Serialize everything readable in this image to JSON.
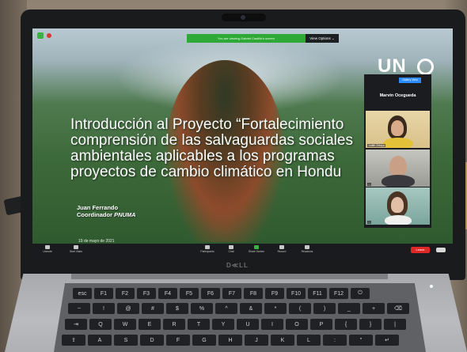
{
  "zoom": {
    "share_notice": "You are viewing Gabriel Castillo's screen",
    "view_options": "View Options ⌄",
    "panel_button": "Gallery View",
    "active_speaker": "Marvin Ocegueda",
    "participants": [
      "Judith Zelaya",
      "...",
      "..."
    ],
    "toolbar": {
      "unmute": "Unmute",
      "start_video": "Start Video",
      "participants": "Participants",
      "chat": "Chat",
      "share_screen": "Share Screen",
      "record": "Record",
      "reactions": "Reactions",
      "end": "Leave"
    }
  },
  "slide": {
    "logo": "UN",
    "title_lines": [
      "Introducción al Proyecto “Fortalecimiento",
      "comprensión de las salvaguardas sociales",
      "ambientales aplicables a los programas",
      "proyectos de cambio climático en Hondu"
    ],
    "presenter": "Juan Ferrando",
    "role_prefix": "Coordinador",
    "role_org": "PNUMA",
    "date": "19 de mayo de 2021"
  },
  "device": {
    "brand": "D≪LL"
  },
  "keyboard": {
    "row1": [
      "esc",
      "F1",
      "F2",
      "F3",
      "F4",
      "F5",
      "F6",
      "F7",
      "F8",
      "F9",
      "F10",
      "F11",
      "F12",
      "⏻"
    ],
    "row2": [
      "~",
      "!",
      "@",
      "#",
      "$",
      "%",
      "^",
      "&",
      "*",
      "(",
      ")",
      "_",
      "+",
      "⌫"
    ],
    "row3": [
      "⇥",
      "Q",
      "W",
      "E",
      "R",
      "T",
      "Y",
      "U",
      "I",
      "O",
      "P",
      "{",
      "}",
      "|"
    ],
    "row4": [
      "⇪",
      "A",
      "S",
      "D",
      "F",
      "G",
      "H",
      "J",
      "K",
      "L",
      ":",
      "\"",
      "↵"
    ]
  },
  "colors": {
    "zoom_green": "#2ea836",
    "zoom_blue": "#2d8cff",
    "leave_red": "#e02828"
  }
}
